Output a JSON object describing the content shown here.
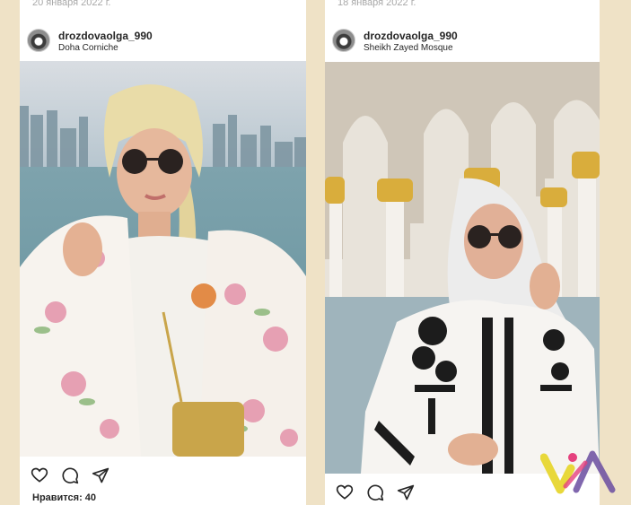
{
  "posts": [
    {
      "date": "20 января 2022 г.",
      "username": "drozdovaolga_990",
      "location": "Doha Corniche",
      "likes": "Нравится: 40",
      "icons": [
        "heart-icon",
        "comment-icon",
        "share-icon"
      ]
    },
    {
      "date": "18 января 2022 г.",
      "username": "drozdovaolga_990",
      "location": "Sheikh Zayed Mosque",
      "icons": [
        "heart-icon",
        "comment-icon",
        "share-icon"
      ]
    }
  ],
  "colors": {
    "background": "#efe2c6",
    "card": "#ffffff",
    "text": "#262626",
    "muted": "#a8a8a8",
    "watermark_yellow": "#e8d83a",
    "watermark_pink": "#e5417e",
    "watermark_purple": "#6a4ca0"
  }
}
